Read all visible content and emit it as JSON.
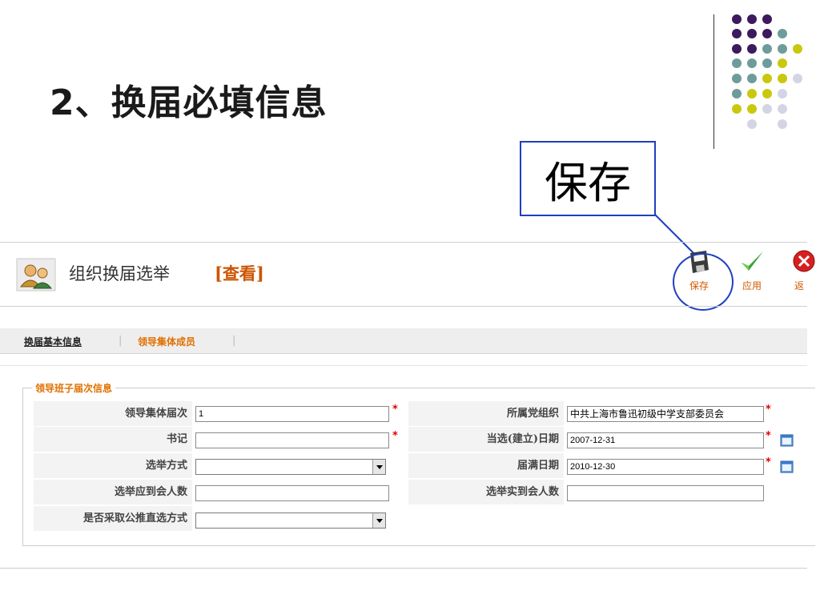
{
  "slide": {
    "title": "2、换届必填信息",
    "callout_text": "保存"
  },
  "header": {
    "title": "组织换届选举",
    "subtitle": "[查看]"
  },
  "toolbar": {
    "save_label": "保存",
    "apply_label": "应用",
    "back_label": "返"
  },
  "tabs": [
    {
      "label": "换届基本信息"
    },
    {
      "label": "领导集体成员"
    }
  ],
  "tab_separator": "|",
  "section": {
    "legend": "领导班子届次信息"
  },
  "form": {
    "leadership_term_label": "领导集体届次",
    "leadership_term_value": "1",
    "secretary_label": "书记",
    "secretary_value": "",
    "election_method_label": "选举方式",
    "election_method_value": "",
    "expected_attendance_label": "选举应到会人数",
    "expected_attendance_value": "",
    "public_recommendation_label": "是否采取公推直选方式",
    "public_recommendation_value": "",
    "party_org_label": "所属党组织",
    "party_org_value": "中共上海市鲁迅初级中学支部委员会",
    "election_date_label": "当选(建立)日期",
    "election_date_value": "2007-12-31",
    "term_end_label": "届满日期",
    "term_end_value": "2010-12-30",
    "actual_attendance_label": "选举实到会人数",
    "actual_attendance_value": "",
    "required_mark": "*"
  },
  "colors": {
    "accent_orange": "#e07000",
    "callout_blue": "#1f3fbf",
    "required_red": "#e00000",
    "dot_purple": "#3d1a5e",
    "dot_teal": "#6e9c9a",
    "dot_yellow": "#c9c80f",
    "dot_light": "#d4d4e4"
  }
}
